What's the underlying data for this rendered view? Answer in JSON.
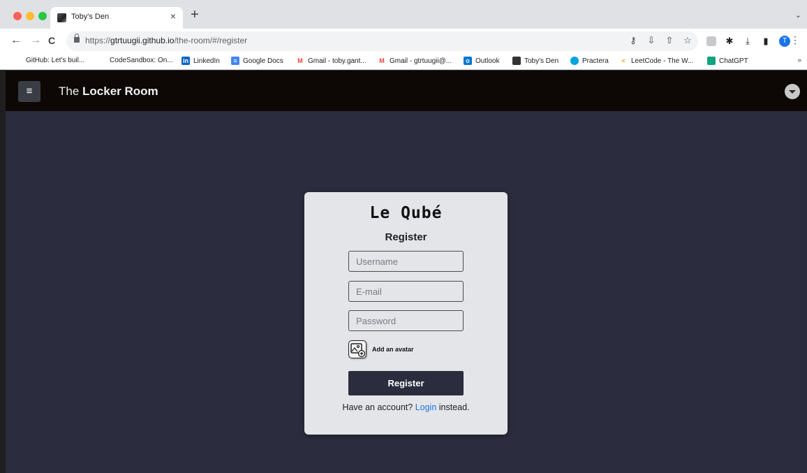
{
  "browser": {
    "tab": {
      "title": "Toby's Den",
      "close": "×"
    },
    "new_tab": "+",
    "url": {
      "prefix": "https://",
      "host": "gtrtuugii.github.io",
      "path": "/the-room/#/register"
    },
    "nav": {
      "back": "←",
      "forward": "→",
      "reload": "C"
    },
    "profile_initial": "T",
    "bookmarks": [
      {
        "label": "GitHub: Let's buil...",
        "icon": "github-icon",
        "color": "#ffffff"
      },
      {
        "label": "CodeSandbox: On...",
        "icon": "codesandbox-icon",
        "color": "#ffffff"
      },
      {
        "label": "LinkedIn",
        "icon": "linkedin-icon",
        "color": "#0a66c2"
      },
      {
        "label": "Google Docs",
        "icon": "google-docs-icon",
        "color": "#4285f4"
      },
      {
        "label": "Gmail - toby.gant...",
        "icon": "gmail-icon",
        "color": "#ea4335"
      },
      {
        "label": "Gmail - gtrtuugii@...",
        "icon": "gmail-icon",
        "color": "#ea4335"
      },
      {
        "label": "Outlook",
        "icon": "outlook-icon",
        "color": "#0078d4"
      },
      {
        "label": "Toby's Den",
        "icon": "tobys-den-icon",
        "color": "#333333"
      },
      {
        "label": "Practera",
        "icon": "practera-icon",
        "color": "#00a3e0"
      },
      {
        "label": "LeetCode - The W...",
        "icon": "leetcode-icon",
        "color": "#f89f1b"
      },
      {
        "label": "ChatGPT",
        "icon": "chatgpt-icon",
        "color": "#10a37f"
      }
    ],
    "bookmarks_more": "»"
  },
  "app": {
    "brand_prefix": "The ",
    "brand_bold": "Locker Room",
    "menu_icon": "≡"
  },
  "form": {
    "logo": "Le Qubé",
    "title": "Register",
    "username_placeholder": "Username",
    "email_placeholder": "E-mail",
    "password_placeholder": "Password",
    "avatar_label": "Add an avatar",
    "submit_label": "Register",
    "alt_prefix": "Have an account? ",
    "alt_link": "Login",
    "alt_suffix": " instead."
  },
  "colors": {
    "page_bg": "#2b2c3e",
    "header_bg": "#0d0805",
    "card_bg": "#e4e5e8",
    "button_bg": "#2b2c3e",
    "link": "#1a73e8"
  }
}
